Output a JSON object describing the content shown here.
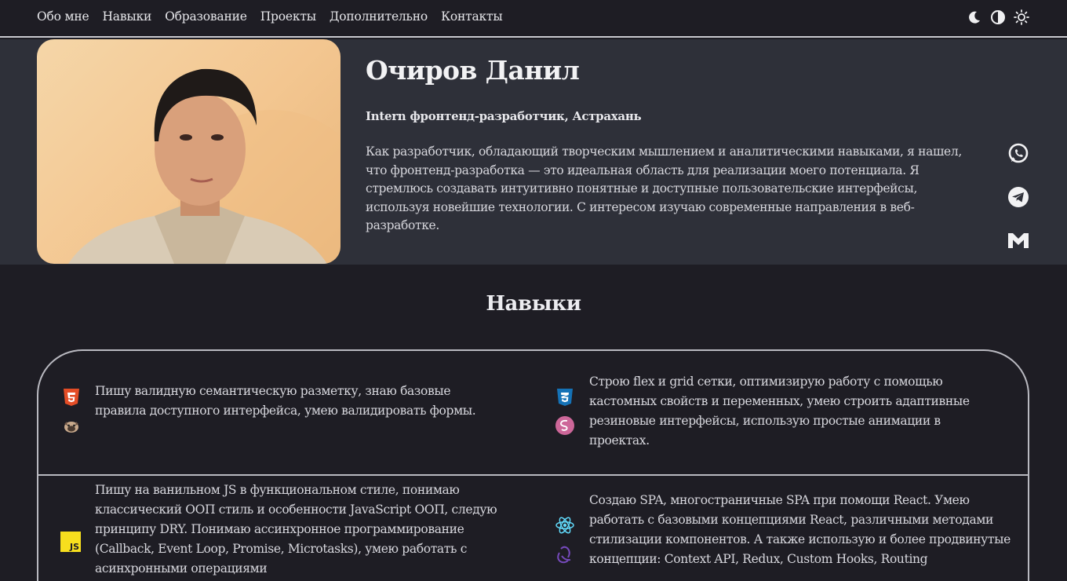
{
  "nav": {
    "links": [
      "Обо мне",
      "Навыки",
      "Образование",
      "Проекты",
      "Дополнительно",
      "Контакты"
    ],
    "theme_icons": [
      "moon-icon",
      "half-circle-icon",
      "sun-icon"
    ]
  },
  "hero": {
    "name": "Очиров Данил",
    "role": "Intern фронтенд-разработчик, Астрахань",
    "about": "Как разработчик, обладающий творческим мышлением и аналитическими навыками, я нашел, что фронтенд-разработка — это идеальная область для реализации моего потенциала. Я стремлюсь создавать интуитивно понятные и доступные пользовательские интерфейсы, используя новейшие технологии. С интересом изучаю современные направления в веб-разработке.",
    "social_icons": [
      "whatsapp-icon",
      "telegram-icon",
      "gmail-icon"
    ]
  },
  "skills": {
    "title": "Навыки",
    "items": [
      {
        "icons": [
          "html5-icon",
          "pug-icon"
        ],
        "text": "Пишу валидную семантическую разметку, знаю базовые правила доступного интерфейса, умею валидировать формы."
      },
      {
        "icons": [
          "css3-icon",
          "sass-icon"
        ],
        "text": "Строю flex и grid сетки, оптимизирую работу с помощью кастомных свойств и переменных, умею строить адаптивные резиновые интерфейсы, использую простые анимации в проектах."
      },
      {
        "icons": [
          "javascript-icon"
        ],
        "text": "Пишу на ванильном JS в функциональном стиле, понимаю классический ООП стиль и особенности JavaScript ООП, следую принципу DRY. Понимаю ассинхронное программирование (Callback, Event Loop, Promise, Microtasks), умею работать с асинхронными операциями"
      },
      {
        "icons": [
          "react-icon",
          "redux-icon"
        ],
        "text": "Создаю SPA, многостраничные SPA при помощи React. Умею работать с базовыми концепциями React, различными методами стилизации компонентов. А также использую и более продвинутые концепции: Context API, Redux, Custom Hooks, Routing"
      }
    ]
  },
  "colors": {
    "background": "#1e1d24",
    "hero_background": "#2e3039",
    "html5": "#e44d26",
    "css3": "#1572b6",
    "sass": "#cd6799",
    "javascript": "#f7df1e",
    "react": "#61dafb",
    "redux": "#764abc"
  }
}
